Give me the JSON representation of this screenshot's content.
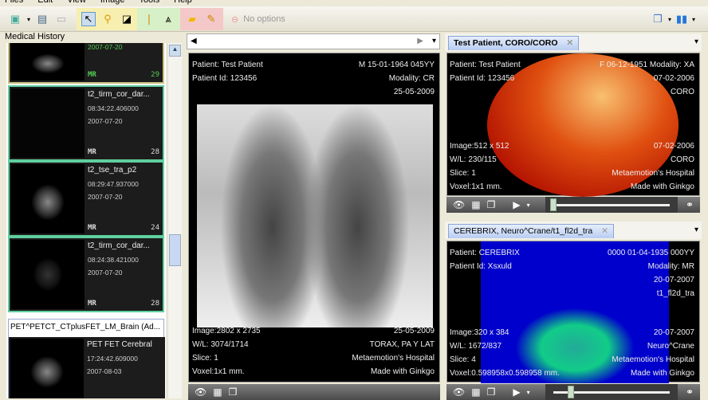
{
  "menu": [
    "Files",
    "Edit",
    "View",
    "Image",
    "Tools",
    "Help"
  ],
  "toolbar": {
    "no_options": "No options"
  },
  "left_panel": {
    "title": "Medical History",
    "items": [
      {
        "title": "",
        "time": "",
        "date": "2007-07-20",
        "modality": "MR",
        "count": "29"
      },
      {
        "title": "t2_tirm_cor_dar...",
        "time": "08:34:22.406000",
        "date": "2007-07-20",
        "modality": "MR",
        "count": "28"
      },
      {
        "title": "t2_tse_tra_p2",
        "time": "08:29:47.937000",
        "date": "2007-07-20",
        "modality": "MR",
        "count": "24"
      },
      {
        "title": "t2_tirm_cor_dar...",
        "time": "08:24:38.421000",
        "date": "2007-07-20",
        "modality": "MR",
        "count": "28"
      }
    ],
    "group2_title": "PET^PETCT_CTplusFET_LM_Brain (Ad...",
    "group2_items": [
      {
        "title": "PET FET Cerebral",
        "time": "17:24:42.609000",
        "date": "2007-08-03"
      }
    ]
  },
  "center": {
    "tl": [
      "Patient: Test Patient",
      "Patient Id: 123456"
    ],
    "tr": [
      "M 15-01-1964 045YY",
      "Modality: CR",
      "25-05-2009"
    ],
    "bl": [
      "Image:2802 x 2735",
      "W/L: 3074/1714",
      "Slice: 1",
      "Voxel:1x1 mm."
    ],
    "br": [
      "25-05-2009",
      "TORAX, PA Y LAT",
      "Metaemotion's Hospital",
      "Made with Ginkgo"
    ]
  },
  "top_right": {
    "tab": "Test Patient, CORO/CORO",
    "tl": [
      "Patient: Test Patient",
      "Patient Id: 123456"
    ],
    "tr": [
      "F 06-12-1951 Modality: XA",
      "07-02-2006",
      "CORO"
    ],
    "bl": [
      "Image:512 x 512",
      "W/L: 230/115",
      "Slice: 1",
      "Voxel:1x1 mm."
    ],
    "br": [
      "07-02-2006",
      "CORO",
      "Metaemotion's Hospital",
      "Made with Ginkgo"
    ],
    "slider": 0.0
  },
  "bottom_right": {
    "tab": "CEREBRIX, Neuro^Crane/t1_fl2d_tra",
    "tl": [
      "Patient: CEREBRIX",
      "Patient Id: Xsxuld"
    ],
    "tr": [
      "0000 01-04-1935 000YY",
      "Modality: MR",
      "20-07-2007",
      "t1_fl2d_tra"
    ],
    "bl": [
      "Image:320 x 384",
      "W/L: 1672/837",
      "Slice: 4",
      "Voxel:0.598958x0.598958 mm."
    ],
    "br": [
      "20-07-2007",
      "Neuro^Crane",
      "Metaemotion's Hospital",
      "Made with Ginkgo"
    ],
    "slider": 0.15
  }
}
